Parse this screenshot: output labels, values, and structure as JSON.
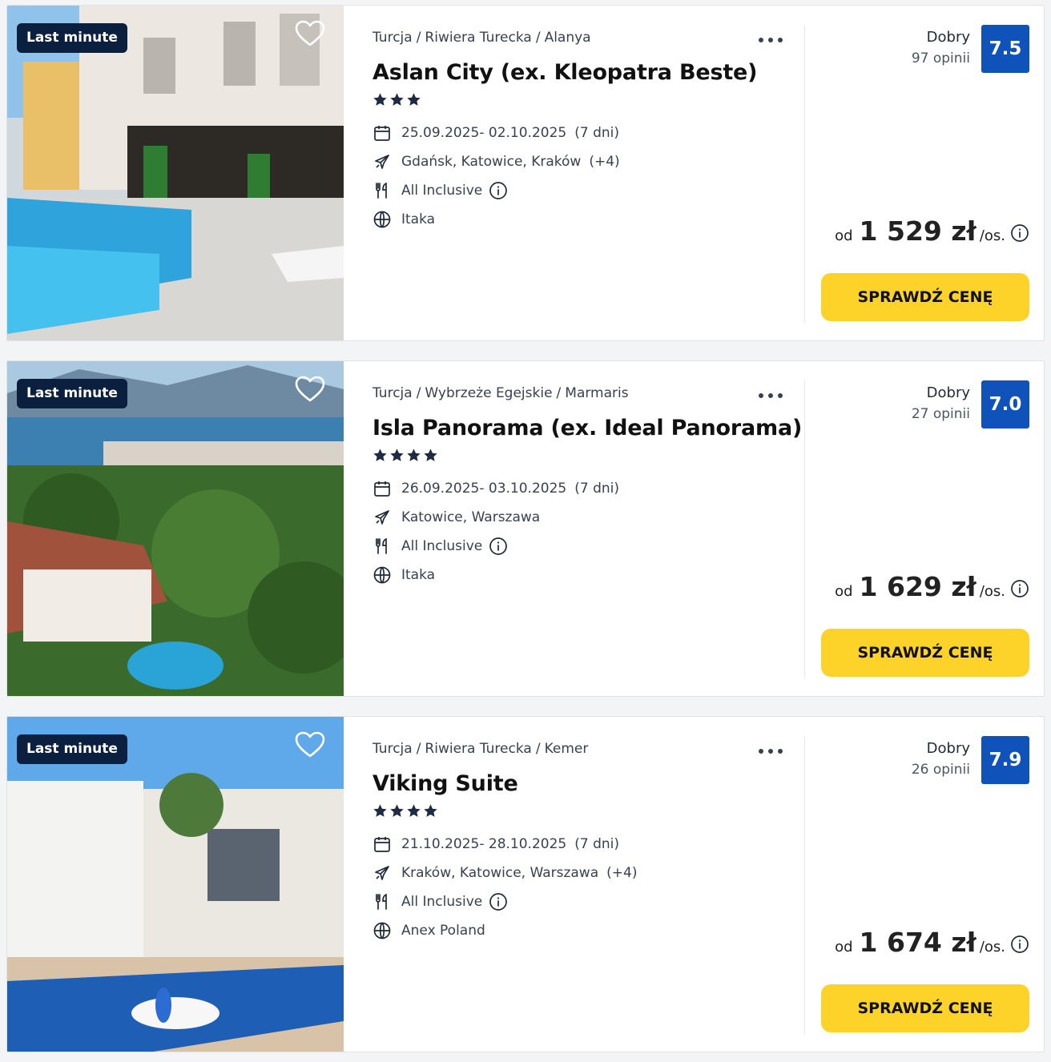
{
  "offers": [
    {
      "badge": "Last minute",
      "breadcrumb": [
        "Turcja",
        "Riwiera Turecka",
        "Alanya"
      ],
      "name": "Aslan City (ex. Kleopatra Beste)",
      "stars": 3,
      "dates": "25.09.2025- 02.10.2025",
      "duration": "(7 dni)",
      "departures": "Gdańsk, Katowice, Kraków",
      "departures_extra": "(+4)",
      "board": "All Inclusive",
      "operator": "Itaka",
      "rating_label": "Dobry",
      "reviews": "97 opinii",
      "score": "7.5",
      "price_prefix": "od",
      "price": "1 529 zł",
      "price_suffix": "/os.",
      "cta": "SPRAWDŹ CENĘ",
      "photo": "hotel-pool-courtyard"
    },
    {
      "badge": "Last minute",
      "breadcrumb": [
        "Turcja",
        "Wybrzeże Egejskie",
        "Marmaris"
      ],
      "name": "Isla Panorama (ex. Ideal Panorama)",
      "stars": 4,
      "dates": "26.09.2025- 03.10.2025",
      "duration": "(7 dni)",
      "departures": "Katowice, Warszawa",
      "departures_extra": "",
      "board": "All Inclusive",
      "operator": "Itaka",
      "rating_label": "Dobry",
      "reviews": "27 opinii",
      "score": "7.0",
      "price_prefix": "od",
      "price": "1 629 zł",
      "price_suffix": "/os.",
      "cta": "SPRAWDŹ CENĘ",
      "photo": "bay-panorama-pines"
    },
    {
      "badge": "Last minute",
      "breadcrumb": [
        "Turcja",
        "Riwiera Turecka",
        "Kemer"
      ],
      "name": "Viking Suite",
      "stars": 4,
      "dates": "21.10.2025- 28.10.2025",
      "duration": "(7 dni)",
      "departures": "Kraków, Katowice, Warszawa",
      "departures_extra": "(+4)",
      "board": "All Inclusive",
      "operator": "Anex Poland",
      "rating_label": "Dobry",
      "reviews": "26 opinii",
      "score": "7.9",
      "price_prefix": "od",
      "price": "1 674 zł",
      "price_suffix": "/os.",
      "cta": "SPRAWDŹ CENĘ",
      "photo": "hotel-pool-inflatable-plane"
    }
  ],
  "colors": {
    "badge_bg": "#0b1f3f",
    "score_bg": "#0f52ba",
    "cta_bg": "#fdd32a",
    "star": "#1f2a44"
  }
}
